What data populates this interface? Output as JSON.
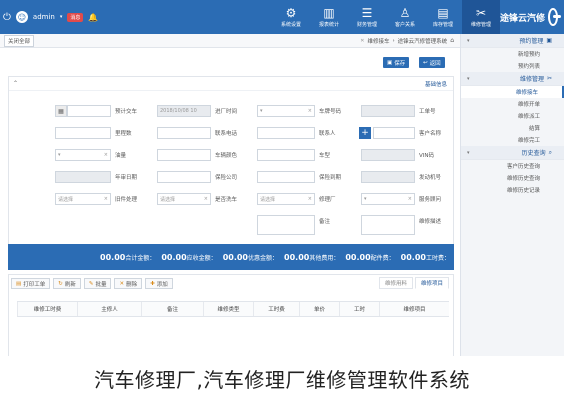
{
  "header": {
    "logo_text": "途锋云汽修",
    "modules": [
      {
        "label": "维修管理",
        "icon": "✂",
        "active": true
      },
      {
        "label": "库存管理",
        "icon": "▤",
        "active": false
      },
      {
        "label": "客户关系",
        "icon": "♙",
        "active": false
      },
      {
        "label": "财务管理",
        "icon": "☰",
        "active": false
      },
      {
        "label": "报表统计",
        "icon": "▥",
        "active": false
      },
      {
        "label": "系统设置",
        "icon": "⚙",
        "active": false
      }
    ],
    "user": {
      "name": "admin",
      "message_badge": "消息",
      "avatar_initial": "☺"
    }
  },
  "sidebar": {
    "sections": [
      {
        "title": "预约管理",
        "items": [
          "新增预约",
          "预约列表"
        ]
      },
      {
        "title": "维修管理",
        "items": [
          "维修接车",
          "维修开单",
          "维修派工",
          "结算",
          "维修完工"
        ]
      },
      {
        "title": "历史查询",
        "items": [
          "客户历史查询",
          "维修历史查询",
          "维修历史记录"
        ]
      }
    ],
    "active_item": "维修接车"
  },
  "breadcrumb": {
    "tab_label": "维修接车",
    "home_label": "途锋云汽修管理系统",
    "left_button": "关闭全部"
  },
  "toolbar": {
    "save_label": "保存",
    "back_label": "返回"
  },
  "form": {
    "panel_title": "基础信息",
    "fields": {
      "work_order_no": "工单号",
      "plate_no": "车牌号码",
      "service_type": "维修类型",
      "in_time": "进厂时间",
      "in_time_value": "2018/10/08 10",
      "est_delivery": "预计交车",
      "customer_name": "客户名称",
      "contact": "联系人",
      "contact_phone": "联系电话",
      "mileage": "里程数",
      "vin": "VIN码",
      "model": "车型",
      "vehicle_color": "车辆颜色",
      "fuel": "油量",
      "engine_no": "发动机号",
      "insurance_expire": "保险到期",
      "insurance_company": "保险公司",
      "annual_inspect": "年审日期",
      "service_advisor": "服务顾问",
      "repair_shop": "修理厂",
      "car_wash": "是否洗车",
      "old_parts": "旧件处理",
      "service_desc": "维修描述",
      "remark": "备注",
      "select_placeholder": "请选择",
      "choose": "请选择",
      "dropdown": "▾"
    }
  },
  "summary": {
    "items": [
      {
        "label": "工时费：",
        "value": "00.00"
      },
      {
        "label": "配件费：",
        "value": "00.00"
      },
      {
        "label": "其他费用：",
        "value": "00.00"
      },
      {
        "label": "优惠金额：",
        "value": "00.00"
      },
      {
        "label": "应收金额：",
        "value": "00.00"
      },
      {
        "label": "合计金额：",
        "value": "00.00"
      }
    ]
  },
  "bottom": {
    "tabs": [
      "维修项目",
      "维修用料"
    ],
    "buttons": [
      "添加",
      "删除",
      "批量",
      "刷新",
      "打印工单"
    ],
    "columns": [
      "维修项目",
      "工时",
      "单价",
      "工时费",
      "维修类型",
      "备注",
      "主修人",
      "维修工时费"
    ]
  },
  "caption": "汽车修理厂,汽车修理厂维修管理软件系统"
}
